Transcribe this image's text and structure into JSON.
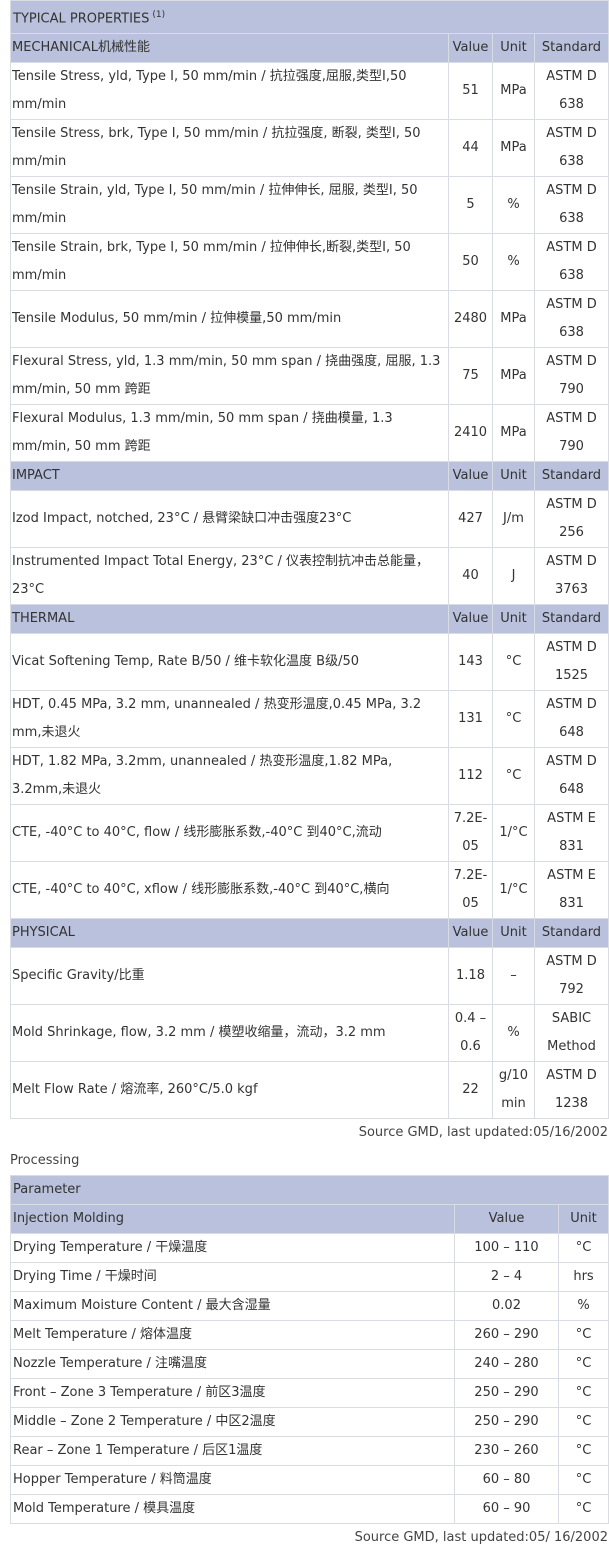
{
  "properties": {
    "title": "TYPICAL PROPERTIES",
    "title_sup": "(1)",
    "sections": [
      {
        "name": "MECHANICAL机械性能",
        "col_value": "Value",
        "col_unit": "Unit",
        "col_standard": "Standard",
        "rows": [
          {
            "property": "Tensile Stress, yld, Type I, 50 mm/min / 抗拉强度,屈服,类型I,50 mm/min",
            "value": "51",
            "unit": "MPa",
            "standard": "ASTM D 638"
          },
          {
            "property": "Tensile Stress, brk, Type I, 50 mm/min / 抗拉强度, 断裂, 类型I, 50 mm/min",
            "value": "44",
            "unit": "MPa",
            "standard": "ASTM D 638"
          },
          {
            "property": "Tensile Strain, yld, Type I, 50 mm/min / 拉伸伸长, 屈服, 类型I, 50 mm/min",
            "value": "5",
            "unit": "%",
            "standard": "ASTM D 638"
          },
          {
            "property": "Tensile Strain, brk, Type I, 50 mm/min / 拉伸伸长,断裂,类型I, 50 mm/min",
            "value": "50",
            "unit": "%",
            "standard": "ASTM D 638"
          },
          {
            "property": "Tensile Modulus, 50 mm/min / 拉伸模量,50 mm/min",
            "value": "2480",
            "unit": "MPa",
            "standard": "ASTM D 638"
          },
          {
            "property": "Flexural Stress, yld, 1.3 mm/min, 50 mm span / 挠曲强度, 屈服, 1.3 mm/min, 50 mm 跨距",
            "value": "75",
            "unit": "MPa",
            "standard": "ASTM D 790"
          },
          {
            "property": "Flexural Modulus, 1.3 mm/min, 50 mm span / 挠曲模量, 1.3 mm/min, 50 mm 跨距",
            "value": "2410",
            "unit": "MPa",
            "standard": "ASTM D 790"
          }
        ]
      },
      {
        "name": "IMPACT",
        "col_value": "Value",
        "col_unit": "Unit",
        "col_standard": "Standard",
        "rows": [
          {
            "property": "Izod Impact, notched, 23°C / 悬臂梁缺口冲击强度23°C",
            "value": "427",
            "unit": "J/m",
            "standard": "ASTM D 256"
          },
          {
            "property": "Instrumented Impact Total Energy, 23°C / 仪表控制抗冲击总能量，23°C",
            "value": "40",
            "unit": "J",
            "standard": "ASTM D 3763"
          }
        ]
      },
      {
        "name": "THERMAL",
        "col_value": "Value",
        "col_unit": "Unit",
        "col_standard": "Standard",
        "rows": [
          {
            "property": "Vicat Softening Temp, Rate B/50 / 维卡软化温度 B级/50",
            "value": "143",
            "unit": "°C",
            "standard": "ASTM D 1525"
          },
          {
            "property": "HDT, 0.45 MPa, 3.2 mm, unannealed / 热变形温度,0.45 MPa, 3.2 mm,未退火",
            "value": "131",
            "unit": "°C",
            "standard": "ASTM D 648"
          },
          {
            "property": "HDT, 1.82 MPa, 3.2mm, unannealed / 热变形温度,1.82 MPa, 3.2mm,未退火",
            "value": "112",
            "unit": "°C",
            "standard": "ASTM D 648"
          },
          {
            "property": "CTE, -40°C to 40°C, flow / 线形膨胀系数,-40°C 到40°C,流动",
            "value": "7.2E-05",
            "unit": "1/°C",
            "standard": "ASTM E 831"
          },
          {
            "property": "CTE, -40°C to 40°C, xflow / 线形膨胀系数,-40°C 到40°C,横向",
            "value": "7.2E-05",
            "unit": "1/°C",
            "standard": "ASTM E 831"
          }
        ]
      },
      {
        "name": "PHYSICAL",
        "col_value": "Value",
        "col_unit": "Unit",
        "col_standard": "Standard",
        "rows": [
          {
            "property": "Specific Gravity/比重",
            "value": "1.18",
            "unit": "–",
            "standard": "ASTM D 792"
          },
          {
            "property": "Mold Shrinkage, flow, 3.2 mm / 模塑收缩量，流动，3.2 mm",
            "value": "0.4 – 0.6",
            "unit": "%",
            "standard": "SABIC Method"
          },
          {
            "property": "Melt Flow Rate / 熔流率, 260°C/5.0 kgf",
            "value": "22",
            "unit": "g/10 min",
            "standard": "ASTM D 1238"
          }
        ]
      }
    ],
    "source": "Source GMD, last updated:05/16/2002"
  },
  "processing": {
    "title": "Processing",
    "header": "Parameter",
    "section": "Injection Molding",
    "col_value": "Value",
    "col_unit": "Unit",
    "rows": [
      {
        "parameter": "Drying Temperature / 干燥温度",
        "value": "100 – 110",
        "unit": "°C"
      },
      {
        "parameter": "Drying Time / 干燥时间",
        "value": "2 – 4",
        "unit": "hrs"
      },
      {
        "parameter": "Maximum Moisture Content / 最大含湿量",
        "value": "0.02",
        "unit": "%"
      },
      {
        "parameter": "Melt Temperature / 熔体温度",
        "value": "260 – 290",
        "unit": "°C"
      },
      {
        "parameter": "Nozzle Temperature / 注嘴温度",
        "value": "240 – 280",
        "unit": "°C"
      },
      {
        "parameter": "Front – Zone 3 Temperature / 前区3温度",
        "value": "250 – 290",
        "unit": "°C"
      },
      {
        "parameter": "Middle – Zone 2 Temperature / 中区2温度",
        "value": "250 – 290",
        "unit": "°C"
      },
      {
        "parameter": "Rear – Zone 1 Temperature / 后区1温度",
        "value": "230 – 260",
        "unit": "°C"
      },
      {
        "parameter": "Hopper Temperature / 料筒温度",
        "value": "60 – 80",
        "unit": "°C"
      },
      {
        "parameter": "Mold Temperature / 模具温度",
        "value": "60 – 90",
        "unit": "°C"
      }
    ],
    "source": "Source GMD, last updated:05/ 16/2002"
  }
}
